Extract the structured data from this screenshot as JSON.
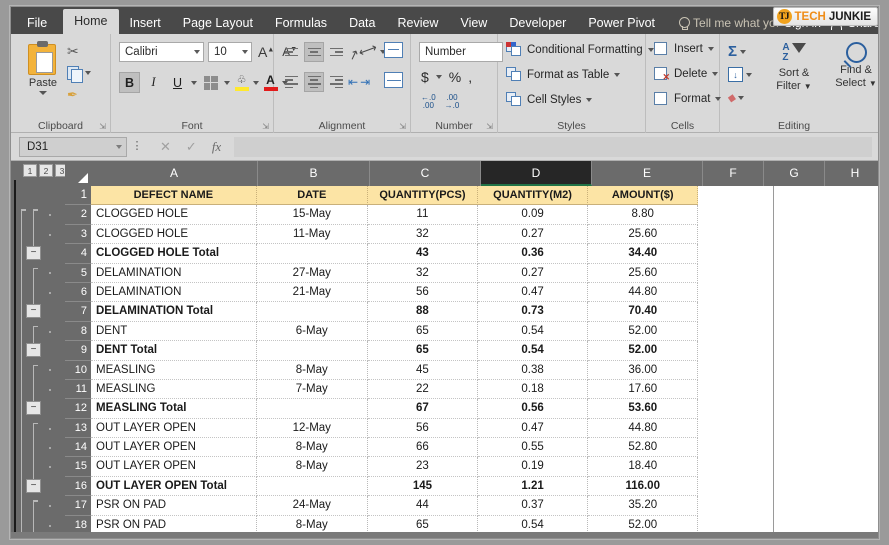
{
  "app": {
    "tabs": [
      {
        "label": "File",
        "active": false
      },
      {
        "label": "Home",
        "active": true
      },
      {
        "label": "Insert",
        "active": false
      },
      {
        "label": "Page Layout",
        "active": false
      },
      {
        "label": "Formulas",
        "active": false
      },
      {
        "label": "Data",
        "active": false
      },
      {
        "label": "Review",
        "active": false
      },
      {
        "label": "View",
        "active": false
      },
      {
        "label": "Developer",
        "active": false
      },
      {
        "label": "Power Pivot",
        "active": false
      }
    ],
    "tell_me": "Tell me what you want to d",
    "sign_in": "Sign in",
    "share": "Share",
    "logo": {
      "badge": "TJ",
      "part1": "TECH",
      "part2": "JUNKIE",
      "accent": "#ef8d19"
    }
  },
  "ribbon": {
    "clipboard": {
      "label": "Clipboard",
      "paste": "Paste",
      "cut_icon": "scissors-icon",
      "copy_icon": "copy-icon",
      "format_painter_icon": "format-painter-icon"
    },
    "font": {
      "label": "Font",
      "font_name": "Calibri",
      "font_size": "10",
      "grow_font": "A",
      "shrink_font": "A",
      "bold": "B",
      "italic": "I",
      "underline": "U",
      "fill_color": "#ffe92e",
      "font_color": "#e21b1b"
    },
    "alignment": {
      "label": "Alignment"
    },
    "number": {
      "label": "Number",
      "format": "Number",
      "currency": "$",
      "percent": "%",
      "comma": ","
    },
    "styles": {
      "label": "Styles",
      "items": [
        {
          "label": "Conditional Formatting"
        },
        {
          "label": "Format as Table"
        },
        {
          "label": "Cell Styles"
        }
      ]
    },
    "cells": {
      "label": "Cells",
      "items": [
        {
          "label": "Insert"
        },
        {
          "label": "Delete"
        },
        {
          "label": "Format"
        }
      ]
    },
    "editing": {
      "label": "Editing",
      "autosum": "autosum-icon",
      "fill": "fill-icon",
      "clear": "clear-icon",
      "sort_filter": "Sort & Filter",
      "sort_filter_l1": "Sort &",
      "sort_filter_l2": "Filter",
      "find_select_l1": "Find &",
      "find_select_l2": "Select"
    }
  },
  "formula_bar": {
    "name_box": "D31",
    "formula": "",
    "cancel_icon": "cancel-icon",
    "enter_icon": "enter-icon",
    "fx_icon": "fx"
  },
  "sheet": {
    "outline_levels": [
      "1",
      "2",
      "3"
    ],
    "columns": [
      {
        "letter": "A",
        "selected": false
      },
      {
        "letter": "B",
        "selected": false
      },
      {
        "letter": "C",
        "selected": false
      },
      {
        "letter": "D",
        "selected": true
      },
      {
        "letter": "E",
        "selected": false
      },
      {
        "letter": "F",
        "selected": false
      },
      {
        "letter": "G",
        "selected": false
      },
      {
        "letter": "H",
        "selected": false
      }
    ],
    "header_fill": "#fce4a5",
    "headers": [
      "DEFECT NAME",
      "DATE",
      "QUANTITY(PCS)",
      "QUANTITY(M2)",
      "AMOUNT($)"
    ],
    "rows": [
      {
        "num": "1",
        "type": "header",
        "cells": [
          "DEFECT NAME",
          "DATE",
          "QUANTITY(PCS)",
          "QUANTITY(M2)",
          "AMOUNT($)"
        ]
      },
      {
        "num": "2",
        "type": "data",
        "collapse": false,
        "cells": [
          "CLOGGED HOLE",
          "15-May",
          "11",
          "0.09",
          "8.80"
        ]
      },
      {
        "num": "3",
        "type": "data",
        "collapse": false,
        "cells": [
          "CLOGGED HOLE",
          "11-May",
          "32",
          "0.27",
          "25.60"
        ]
      },
      {
        "num": "4",
        "type": "total",
        "collapse": true,
        "cells": [
          "CLOGGED HOLE Total",
          "",
          "43",
          "0.36",
          "34.40"
        ]
      },
      {
        "num": "5",
        "type": "data",
        "collapse": false,
        "cells": [
          "DELAMINATION",
          "27-May",
          "32",
          "0.27",
          "25.60"
        ]
      },
      {
        "num": "6",
        "type": "data",
        "collapse": false,
        "cells": [
          "DELAMINATION",
          "21-May",
          "56",
          "0.47",
          "44.80"
        ]
      },
      {
        "num": "7",
        "type": "total",
        "collapse": true,
        "cells": [
          "DELAMINATION Total",
          "",
          "88",
          "0.73",
          "70.40"
        ]
      },
      {
        "num": "8",
        "type": "data",
        "collapse": false,
        "cells": [
          "DENT",
          "6-May",
          "65",
          "0.54",
          "52.00"
        ]
      },
      {
        "num": "9",
        "type": "total",
        "collapse": true,
        "cells": [
          "DENT Total",
          "",
          "65",
          "0.54",
          "52.00"
        ]
      },
      {
        "num": "10",
        "type": "data",
        "collapse": false,
        "cells": [
          "MEASLING",
          "8-May",
          "45",
          "0.38",
          "36.00"
        ]
      },
      {
        "num": "11",
        "type": "data",
        "collapse": false,
        "cells": [
          "MEASLING",
          "7-May",
          "22",
          "0.18",
          "17.60"
        ]
      },
      {
        "num": "12",
        "type": "total",
        "collapse": true,
        "cells": [
          "MEASLING Total",
          "",
          "67",
          "0.56",
          "53.60"
        ]
      },
      {
        "num": "13",
        "type": "data",
        "collapse": false,
        "cells": [
          "OUT LAYER OPEN",
          "12-May",
          "56",
          "0.47",
          "44.80"
        ]
      },
      {
        "num": "14",
        "type": "data",
        "collapse": false,
        "cells": [
          "OUT LAYER OPEN",
          "8-May",
          "66",
          "0.55",
          "52.80"
        ]
      },
      {
        "num": "15",
        "type": "data",
        "collapse": false,
        "cells": [
          "OUT LAYER OPEN",
          "8-May",
          "23",
          "0.19",
          "18.40"
        ]
      },
      {
        "num": "16",
        "type": "total",
        "collapse": true,
        "cells": [
          "OUT LAYER OPEN Total",
          "",
          "145",
          "1.21",
          "116.00"
        ]
      },
      {
        "num": "17",
        "type": "data",
        "collapse": false,
        "cells": [
          "PSR ON PAD",
          "24-May",
          "44",
          "0.37",
          "35.20"
        ]
      },
      {
        "num": "18",
        "type": "data",
        "collapse": false,
        "cells": [
          "PSR ON PAD",
          "8-May",
          "65",
          "0.54",
          "52.00"
        ]
      }
    ]
  }
}
